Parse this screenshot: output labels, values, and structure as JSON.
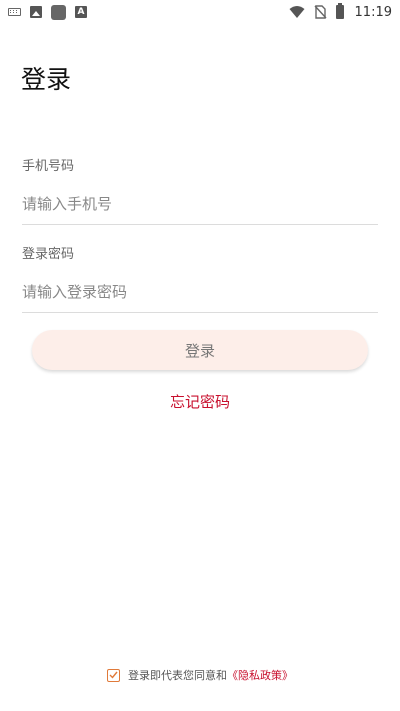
{
  "status_bar": {
    "time": "11:19",
    "icons": [
      "keyboard-icon",
      "image-icon",
      "square-icon",
      "a-icon",
      "wifi-icon",
      "no-sim-icon",
      "battery-icon"
    ]
  },
  "page": {
    "title": "登录"
  },
  "phone": {
    "label": "手机号码",
    "value": "",
    "placeholder": "请输入手机号"
  },
  "password": {
    "label": "登录密码",
    "value": "",
    "placeholder": "请输入登录密码"
  },
  "login_button": {
    "label": "登录",
    "background": "#fdeee9"
  },
  "forgot": {
    "label": "忘记密码"
  },
  "agreement": {
    "checked": true,
    "text": "登录即代表您同意和",
    "link": "《隐私政策》"
  },
  "colors": {
    "accent": "#c8102e",
    "checkbox": "#e07a3a"
  }
}
